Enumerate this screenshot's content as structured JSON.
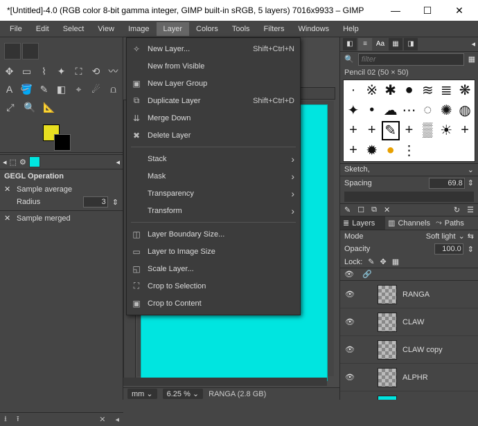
{
  "window": {
    "title": "*[Untitled]-4.0 (RGB color 8-bit gamma integer, GIMP built-in sRGB, 5 layers) 7016x9933 – GIMP",
    "min": "—",
    "max": "☐",
    "close": "✕"
  },
  "menubar": [
    "File",
    "Edit",
    "Select",
    "View",
    "Image",
    "Layer",
    "Colors",
    "Tools",
    "Filters",
    "Windows",
    "Help"
  ],
  "menubar_open_index": 5,
  "dropdown": [
    {
      "icon": "✧",
      "label": "New Layer...",
      "shortcut": "Shift+Ctrl+N",
      "hi": true
    },
    {
      "icon": "",
      "label": "New from Visible",
      "shortcut": ""
    },
    {
      "icon": "▣",
      "label": "New Layer Group",
      "shortcut": ""
    },
    {
      "icon": "⧉",
      "label": "Duplicate Layer",
      "shortcut": "Shift+Ctrl+D"
    },
    {
      "icon": "⇊",
      "label": "Merge Down",
      "shortcut": ""
    },
    {
      "icon": "✖",
      "label": "Delete Layer",
      "shortcut": ""
    },
    {
      "sep": true
    },
    {
      "icon": "",
      "label": "Stack",
      "submenu": true
    },
    {
      "icon": "",
      "label": "Mask",
      "submenu": true
    },
    {
      "icon": "",
      "label": "Transparency",
      "submenu": true
    },
    {
      "icon": "",
      "label": "Transform",
      "submenu": true
    },
    {
      "sep": true
    },
    {
      "icon": "◫",
      "label": "Layer Boundary Size...",
      "shortcut": ""
    },
    {
      "icon": "▭",
      "label": "Layer to Image Size",
      "shortcut": ""
    },
    {
      "icon": "◱",
      "label": "Scale Layer...",
      "shortcut": ""
    },
    {
      "icon": "⛶",
      "label": "Crop to Selection",
      "shortcut": ""
    },
    {
      "icon": "▣",
      "label": "Crop to Content",
      "shortcut": ""
    }
  ],
  "leftpanel": {
    "gegl_title": "GEGL Operation",
    "sample_average": "Sample average",
    "radius_label": "Radius",
    "radius_value": "3",
    "sample_merged": "Sample merged"
  },
  "statusbar": {
    "unit": "mm ⌄",
    "zoom": "6.25 % ⌄",
    "text": "RANGA (2.8 GB)"
  },
  "right": {
    "filter_placeholder": "filter",
    "brush_name": "Pencil 02 (50 × 50)",
    "sketch_label": "Sketch,",
    "spacing_label": "Spacing",
    "spacing_value": "69.8",
    "tab_layers": "Layers",
    "tab_channels": "Channels",
    "tab_paths": "Paths",
    "mode_label": "Mode",
    "mode_value": "Soft light",
    "opacity_label": "Opacity",
    "opacity_value": "100.0",
    "lock_label": "Lock:",
    "layers": [
      "RANGA",
      "CLAW",
      "CLAW copy",
      "ALPHR",
      ""
    ]
  },
  "bottombar": {
    "dl": "⭳",
    "up": "⭱",
    "del": "✕"
  }
}
